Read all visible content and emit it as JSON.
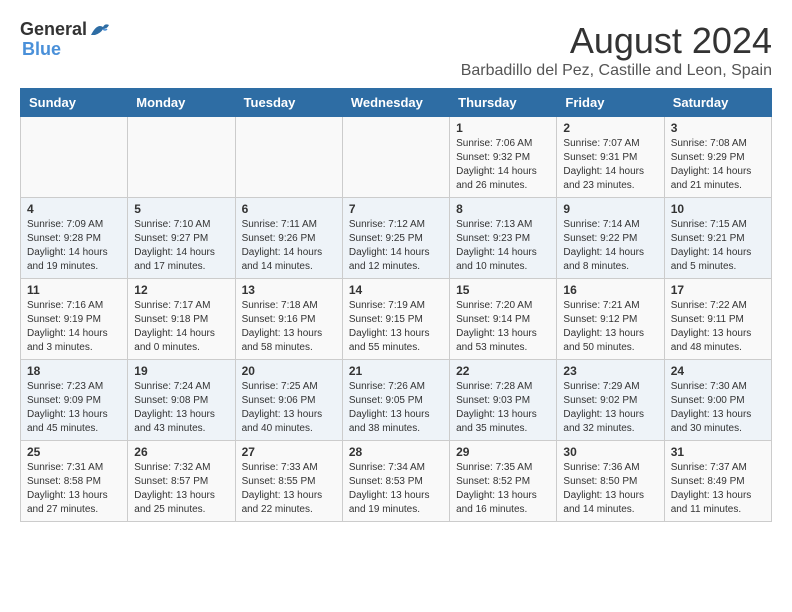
{
  "header": {
    "logo_general": "General",
    "logo_blue": "Blue",
    "month_year": "August 2024",
    "location": "Barbadillo del Pez, Castille and Leon, Spain"
  },
  "days_of_week": [
    "Sunday",
    "Monday",
    "Tuesday",
    "Wednesday",
    "Thursday",
    "Friday",
    "Saturday"
  ],
  "weeks": [
    [
      {
        "day": "",
        "info": ""
      },
      {
        "day": "",
        "info": ""
      },
      {
        "day": "",
        "info": ""
      },
      {
        "day": "",
        "info": ""
      },
      {
        "day": "1",
        "info": "Sunrise: 7:06 AM\nSunset: 9:32 PM\nDaylight: 14 hours and 26 minutes."
      },
      {
        "day": "2",
        "info": "Sunrise: 7:07 AM\nSunset: 9:31 PM\nDaylight: 14 hours and 23 minutes."
      },
      {
        "day": "3",
        "info": "Sunrise: 7:08 AM\nSunset: 9:29 PM\nDaylight: 14 hours and 21 minutes."
      }
    ],
    [
      {
        "day": "4",
        "info": "Sunrise: 7:09 AM\nSunset: 9:28 PM\nDaylight: 14 hours and 19 minutes."
      },
      {
        "day": "5",
        "info": "Sunrise: 7:10 AM\nSunset: 9:27 PM\nDaylight: 14 hours and 17 minutes."
      },
      {
        "day": "6",
        "info": "Sunrise: 7:11 AM\nSunset: 9:26 PM\nDaylight: 14 hours and 14 minutes."
      },
      {
        "day": "7",
        "info": "Sunrise: 7:12 AM\nSunset: 9:25 PM\nDaylight: 14 hours and 12 minutes."
      },
      {
        "day": "8",
        "info": "Sunrise: 7:13 AM\nSunset: 9:23 PM\nDaylight: 14 hours and 10 minutes."
      },
      {
        "day": "9",
        "info": "Sunrise: 7:14 AM\nSunset: 9:22 PM\nDaylight: 14 hours and 8 minutes."
      },
      {
        "day": "10",
        "info": "Sunrise: 7:15 AM\nSunset: 9:21 PM\nDaylight: 14 hours and 5 minutes."
      }
    ],
    [
      {
        "day": "11",
        "info": "Sunrise: 7:16 AM\nSunset: 9:19 PM\nDaylight: 14 hours and 3 minutes."
      },
      {
        "day": "12",
        "info": "Sunrise: 7:17 AM\nSunset: 9:18 PM\nDaylight: 14 hours and 0 minutes."
      },
      {
        "day": "13",
        "info": "Sunrise: 7:18 AM\nSunset: 9:16 PM\nDaylight: 13 hours and 58 minutes."
      },
      {
        "day": "14",
        "info": "Sunrise: 7:19 AM\nSunset: 9:15 PM\nDaylight: 13 hours and 55 minutes."
      },
      {
        "day": "15",
        "info": "Sunrise: 7:20 AM\nSunset: 9:14 PM\nDaylight: 13 hours and 53 minutes."
      },
      {
        "day": "16",
        "info": "Sunrise: 7:21 AM\nSunset: 9:12 PM\nDaylight: 13 hours and 50 minutes."
      },
      {
        "day": "17",
        "info": "Sunrise: 7:22 AM\nSunset: 9:11 PM\nDaylight: 13 hours and 48 minutes."
      }
    ],
    [
      {
        "day": "18",
        "info": "Sunrise: 7:23 AM\nSunset: 9:09 PM\nDaylight: 13 hours and 45 minutes."
      },
      {
        "day": "19",
        "info": "Sunrise: 7:24 AM\nSunset: 9:08 PM\nDaylight: 13 hours and 43 minutes."
      },
      {
        "day": "20",
        "info": "Sunrise: 7:25 AM\nSunset: 9:06 PM\nDaylight: 13 hours and 40 minutes."
      },
      {
        "day": "21",
        "info": "Sunrise: 7:26 AM\nSunset: 9:05 PM\nDaylight: 13 hours and 38 minutes."
      },
      {
        "day": "22",
        "info": "Sunrise: 7:28 AM\nSunset: 9:03 PM\nDaylight: 13 hours and 35 minutes."
      },
      {
        "day": "23",
        "info": "Sunrise: 7:29 AM\nSunset: 9:02 PM\nDaylight: 13 hours and 32 minutes."
      },
      {
        "day": "24",
        "info": "Sunrise: 7:30 AM\nSunset: 9:00 PM\nDaylight: 13 hours and 30 minutes."
      }
    ],
    [
      {
        "day": "25",
        "info": "Sunrise: 7:31 AM\nSunset: 8:58 PM\nDaylight: 13 hours and 27 minutes."
      },
      {
        "day": "26",
        "info": "Sunrise: 7:32 AM\nSunset: 8:57 PM\nDaylight: 13 hours and 25 minutes."
      },
      {
        "day": "27",
        "info": "Sunrise: 7:33 AM\nSunset: 8:55 PM\nDaylight: 13 hours and 22 minutes."
      },
      {
        "day": "28",
        "info": "Sunrise: 7:34 AM\nSunset: 8:53 PM\nDaylight: 13 hours and 19 minutes."
      },
      {
        "day": "29",
        "info": "Sunrise: 7:35 AM\nSunset: 8:52 PM\nDaylight: 13 hours and 16 minutes."
      },
      {
        "day": "30",
        "info": "Sunrise: 7:36 AM\nSunset: 8:50 PM\nDaylight: 13 hours and 14 minutes."
      },
      {
        "day": "31",
        "info": "Sunrise: 7:37 AM\nSunset: 8:49 PM\nDaylight: 13 hours and 11 minutes."
      }
    ]
  ]
}
